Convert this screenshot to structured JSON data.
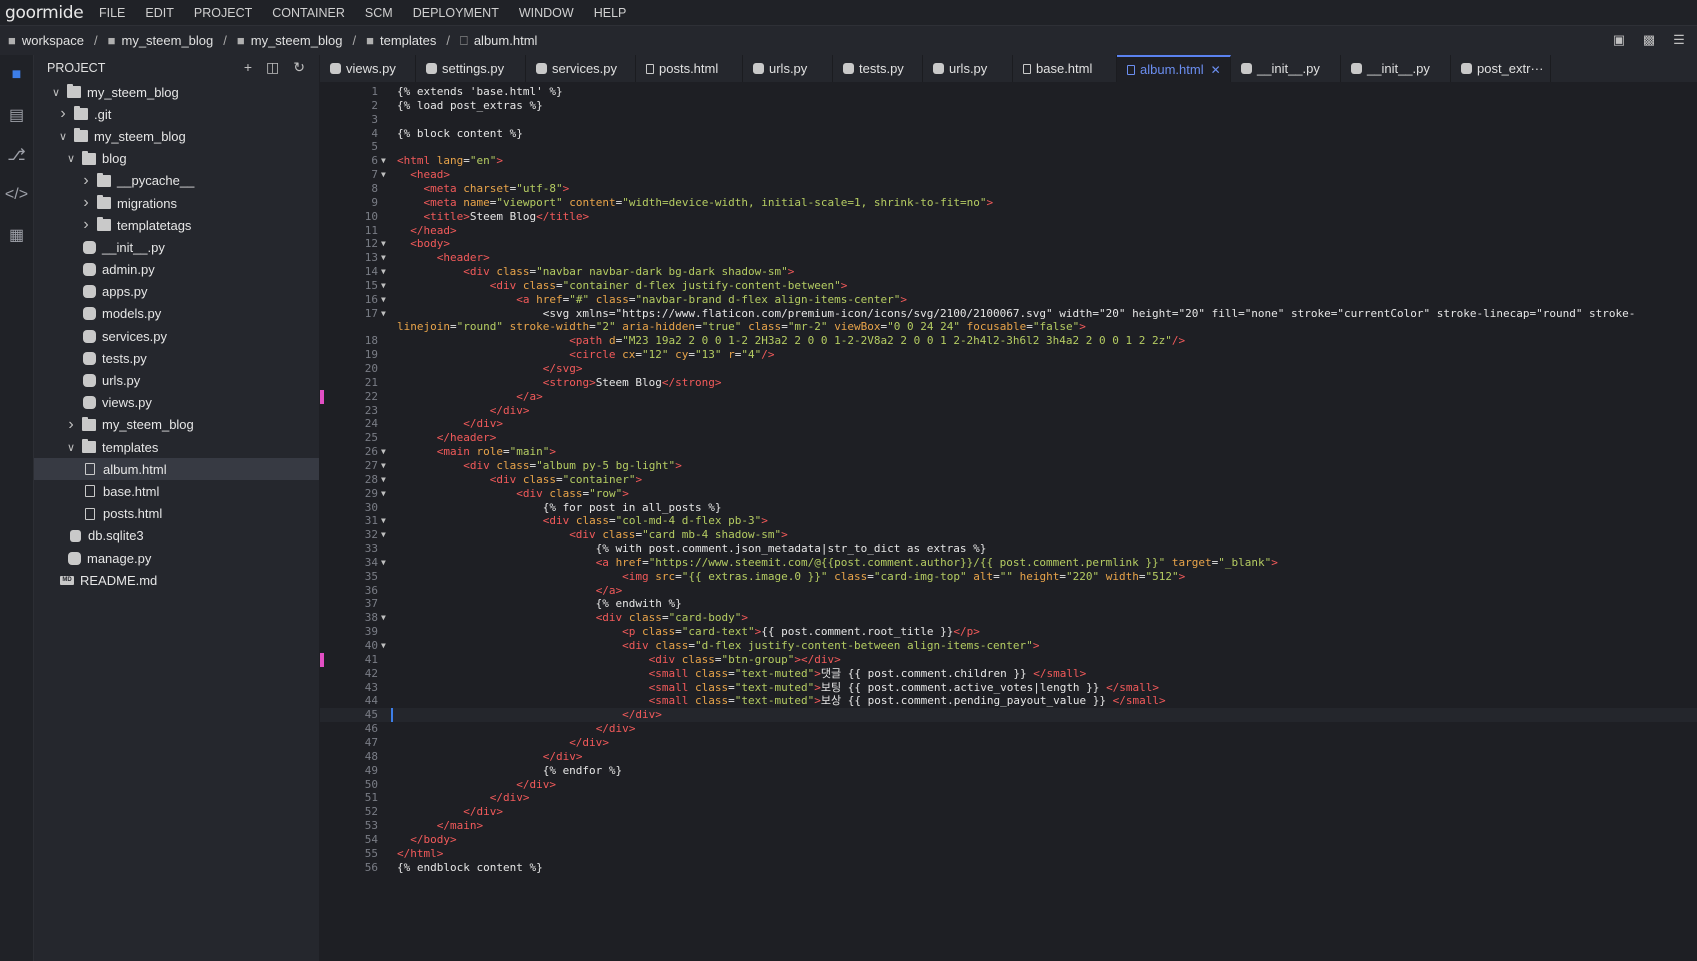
{
  "app": {
    "logo": "goormide"
  },
  "menu": [
    "FILE",
    "EDIT",
    "PROJECT",
    "CONTAINER",
    "SCM",
    "DEPLOYMENT",
    "WINDOW",
    "HELP"
  ],
  "breadcrumb": [
    "workspace",
    "my_steem_blog",
    "my_steem_blog",
    "templates",
    "album.html"
  ],
  "sidebar": {
    "title": "PROJECT",
    "tree": [
      {
        "label": "my_steem_blog",
        "level": 0,
        "type": "folder",
        "state": "open"
      },
      {
        "label": ".git",
        "level": 1,
        "type": "folder",
        "state": "closed"
      },
      {
        "label": "my_steem_blog",
        "level": 1,
        "type": "folder",
        "state": "open"
      },
      {
        "label": "blog",
        "level": 2,
        "type": "folder",
        "state": "open"
      },
      {
        "label": "__pycache__",
        "level": 3,
        "type": "folder",
        "state": "closed"
      },
      {
        "label": "migrations",
        "level": 3,
        "type": "folder",
        "state": "closed"
      },
      {
        "label": "templatetags",
        "level": 3,
        "type": "folder",
        "state": "closed"
      },
      {
        "label": "__init__.py",
        "level": 3,
        "type": "python"
      },
      {
        "label": "admin.py",
        "level": 3,
        "type": "python"
      },
      {
        "label": "apps.py",
        "level": 3,
        "type": "python"
      },
      {
        "label": "models.py",
        "level": 3,
        "type": "python"
      },
      {
        "label": "services.py",
        "level": 3,
        "type": "python"
      },
      {
        "label": "tests.py",
        "level": 3,
        "type": "python"
      },
      {
        "label": "urls.py",
        "level": 3,
        "type": "python"
      },
      {
        "label": "views.py",
        "level": 3,
        "type": "python"
      },
      {
        "label": "my_steem_blog",
        "level": 2,
        "type": "folder",
        "state": "closed"
      },
      {
        "label": "templates",
        "level": 2,
        "type": "folder",
        "state": "open"
      },
      {
        "label": "album.html",
        "level": 3,
        "type": "html",
        "selected": true
      },
      {
        "label": "base.html",
        "level": 3,
        "type": "html"
      },
      {
        "label": "posts.html",
        "level": 3,
        "type": "html"
      },
      {
        "label": "db.sqlite3",
        "level": 2,
        "type": "db"
      },
      {
        "label": "manage.py",
        "level": 2,
        "type": "python"
      },
      {
        "label": "README.md",
        "level": 1,
        "type": "md"
      }
    ]
  },
  "tabs": [
    {
      "label": "views.py",
      "type": "python"
    },
    {
      "label": "settings.py",
      "type": "python"
    },
    {
      "label": "services.py",
      "type": "python"
    },
    {
      "label": "posts.html",
      "type": "html"
    },
    {
      "label": "urls.py",
      "type": "python"
    },
    {
      "label": "tests.py",
      "type": "python"
    },
    {
      "label": "urls.py",
      "type": "python"
    },
    {
      "label": "base.html",
      "type": "html"
    },
    {
      "label": "album.html",
      "type": "html",
      "active": true
    },
    {
      "label": "__init__.py",
      "type": "python"
    },
    {
      "label": "__init__.py",
      "type": "python"
    },
    {
      "label": "post_extr···",
      "type": "python"
    }
  ],
  "editor": {
    "current_line": 45,
    "modified_lines": [
      22,
      41
    ],
    "lines": [
      {
        "n": "1",
        "fold": false,
        "text": "{% extends 'base.html' %}"
      },
      {
        "n": "2",
        "fold": false,
        "text": "{% load post_extras %}"
      },
      {
        "n": "3",
        "fold": false,
        "text": ""
      },
      {
        "n": "4",
        "fold": false,
        "text": "{% block content %}"
      },
      {
        "n": "5",
        "fold": false,
        "text": ""
      },
      {
        "n": "6",
        "fold": true,
        "text": "<html lang=\"en\">"
      },
      {
        "n": "7",
        "fold": true,
        "text": "  <head>"
      },
      {
        "n": "8",
        "fold": false,
        "text": "    <meta charset=\"utf-8\">"
      },
      {
        "n": "9",
        "fold": false,
        "text": "    <meta name=\"viewport\" content=\"width=device-width, initial-scale=1, shrink-to-fit=no\">"
      },
      {
        "n": "10",
        "fold": false,
        "text": "    <title>Steem Blog</title>"
      },
      {
        "n": "11",
        "fold": false,
        "text": "  </head>"
      },
      {
        "n": "12",
        "fold": true,
        "text": "  <body>"
      },
      {
        "n": "13",
        "fold": true,
        "text": "      <header>"
      },
      {
        "n": "14",
        "fold": true,
        "text": "          <div class=\"navbar navbar-dark bg-dark shadow-sm\">"
      },
      {
        "n": "15",
        "fold": true,
        "text": "              <div class=\"container d-flex justify-content-between\">"
      },
      {
        "n": "16",
        "fold": true,
        "text": "                  <a href=\"#\" class=\"navbar-brand d-flex align-items-center\">"
      },
      {
        "n": "17",
        "fold": true,
        "text": "                      <svg xmlns=\"https://www.flaticon.com/premium-icon/icons/svg/2100/2100067.svg\" width=\"20\" height=\"20\" fill=\"none\" stroke=\"currentColor\" stroke-linecap=\"round\" stroke-"
      },
      {
        "n": "",
        "fold": false,
        "text": "linejoin=\"round\" stroke-width=\"2\" aria-hidden=\"true\" class=\"mr-2\" viewBox=\"0 0 24 24\" focusable=\"false\">"
      },
      {
        "n": "18",
        "fold": false,
        "text": "                          <path d=\"M23 19a2 2 0 0 1-2 2H3a2 2 0 0 1-2-2V8a2 2 0 0 1 2-2h4l2-3h6l2 3h4a2 2 0 0 1 2 2z\"/>"
      },
      {
        "n": "19",
        "fold": false,
        "text": "                          <circle cx=\"12\" cy=\"13\" r=\"4\"/>"
      },
      {
        "n": "20",
        "fold": false,
        "text": "                      </svg>"
      },
      {
        "n": "21",
        "fold": false,
        "text": "                      <strong>Steem Blog</strong>"
      },
      {
        "n": "22",
        "fold": false,
        "text": "                  </a>"
      },
      {
        "n": "23",
        "fold": false,
        "text": "              </div>"
      },
      {
        "n": "24",
        "fold": false,
        "text": "          </div>"
      },
      {
        "n": "25",
        "fold": false,
        "text": "      </header>"
      },
      {
        "n": "26",
        "fold": true,
        "text": "      <main role=\"main\">"
      },
      {
        "n": "27",
        "fold": true,
        "text": "          <div class=\"album py-5 bg-light\">"
      },
      {
        "n": "28",
        "fold": true,
        "text": "              <div class=\"container\">"
      },
      {
        "n": "29",
        "fold": true,
        "text": "                  <div class=\"row\">"
      },
      {
        "n": "30",
        "fold": false,
        "text": "                      {% for post in all_posts %}"
      },
      {
        "n": "31",
        "fold": true,
        "text": "                      <div class=\"col-md-4 d-flex pb-3\">"
      },
      {
        "n": "32",
        "fold": true,
        "text": "                          <div class=\"card mb-4 shadow-sm\">"
      },
      {
        "n": "33",
        "fold": false,
        "text": "                              {% with post.comment.json_metadata|str_to_dict as extras %}"
      },
      {
        "n": "34",
        "fold": true,
        "text": "                              <a href=\"https://www.steemit.com/@{{post.comment.author}}/{{ post.comment.permlink }}\" target=\"_blank\">"
      },
      {
        "n": "35",
        "fold": false,
        "text": "                                  <img src=\"{{ extras.image.0 }}\" class=\"card-img-top\" alt=\"\" height=\"220\" width=\"512\">"
      },
      {
        "n": "36",
        "fold": false,
        "text": "                              </a>"
      },
      {
        "n": "37",
        "fold": false,
        "text": "                              {% endwith %}"
      },
      {
        "n": "38",
        "fold": true,
        "text": "                              <div class=\"card-body\">"
      },
      {
        "n": "39",
        "fold": false,
        "text": "                                  <p class=\"card-text\">{{ post.comment.root_title }}</p>"
      },
      {
        "n": "40",
        "fold": true,
        "text": "                                  <div class=\"d-flex justify-content-between align-items-center\">"
      },
      {
        "n": "41",
        "fold": false,
        "text": "                                      <div class=\"btn-group\"></div>"
      },
      {
        "n": "42",
        "fold": false,
        "text": "                                      <small class=\"text-muted\">댓글 {{ post.comment.children }} </small>"
      },
      {
        "n": "43",
        "fold": false,
        "text": "                                      <small class=\"text-muted\">보팅 {{ post.comment.active_votes|length }} </small>"
      },
      {
        "n": "44",
        "fold": false,
        "text": "                                      <small class=\"text-muted\">보상 {{ post.comment.pending_payout_value }} </small>"
      },
      {
        "n": "45",
        "fold": false,
        "text": "                                  </div>"
      },
      {
        "n": "46",
        "fold": false,
        "text": "                              </div>"
      },
      {
        "n": "47",
        "fold": false,
        "text": "                          </div>"
      },
      {
        "n": "48",
        "fold": false,
        "text": "                      </div>"
      },
      {
        "n": "49",
        "fold": false,
        "text": "                      {% endfor %}"
      },
      {
        "n": "50",
        "fold": false,
        "text": "                  </div>"
      },
      {
        "n": "51",
        "fold": false,
        "text": "              </div>"
      },
      {
        "n": "52",
        "fold": false,
        "text": "          </div>"
      },
      {
        "n": "53",
        "fold": false,
        "text": "      </main>"
      },
      {
        "n": "54",
        "fold": false,
        "text": "  </body>"
      },
      {
        "n": "55",
        "fold": false,
        "text": "</html>"
      },
      {
        "n": "56",
        "fold": false,
        "text": "{% endblock content %}"
      }
    ]
  }
}
